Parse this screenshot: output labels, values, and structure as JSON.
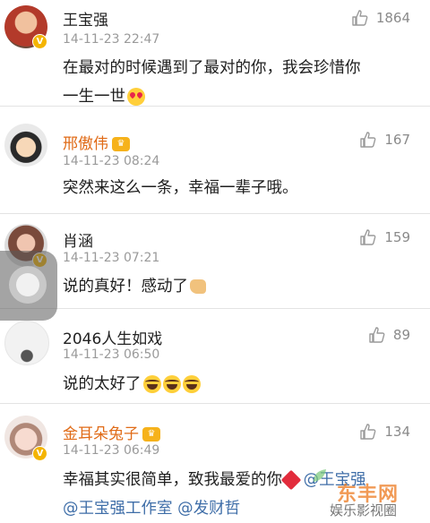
{
  "comments": [
    {
      "name": "王宝强",
      "time": "14-11-23 22:47",
      "likes": "1864",
      "text_lines": [
        "在最对的时候遇到了最对的你，我会珍惜你",
        "一生一世"
      ],
      "emoji": "heart-eyes-emoji",
      "verified": true,
      "vip": false
    },
    {
      "name": "邢傲伟",
      "time": "14-11-23 08:24",
      "likes": "167",
      "text_lines": [
        "突然来这么一条，幸福一辈子哦。"
      ],
      "verified": false,
      "vip": true
    },
    {
      "name": "肖涵",
      "time": "14-11-23 07:21",
      "likes": "159",
      "text_lines": [
        "说的真好！感动了"
      ],
      "emoji": "thumbs-up-emoji",
      "verified": true,
      "vip": false
    },
    {
      "name": "2046人生如戏",
      "time": "14-11-23 06:50",
      "likes": "89",
      "text_lines": [
        "说的太好了"
      ],
      "emoji": "laughing-tears-emoji",
      "verified": false,
      "vip": false
    },
    {
      "name": "金耳朵兔子",
      "time": "14-11-23 06:49",
      "likes": "134",
      "text_lines": [
        "幸福其实很简单，致我最爱的你"
      ],
      "mentions": [
        "@王宝强",
        "@王宝强工作室",
        "@发财哲"
      ],
      "verified": true,
      "vip": true
    }
  ],
  "watermark": {
    "logo_text": "东丰网",
    "sub_text": "娱乐影视圈"
  },
  "colors": {
    "vip_name": "#e06b17",
    "mention": "#3f6ea8",
    "verified_badge": "#f4b400",
    "time": "#9a9a9a"
  }
}
